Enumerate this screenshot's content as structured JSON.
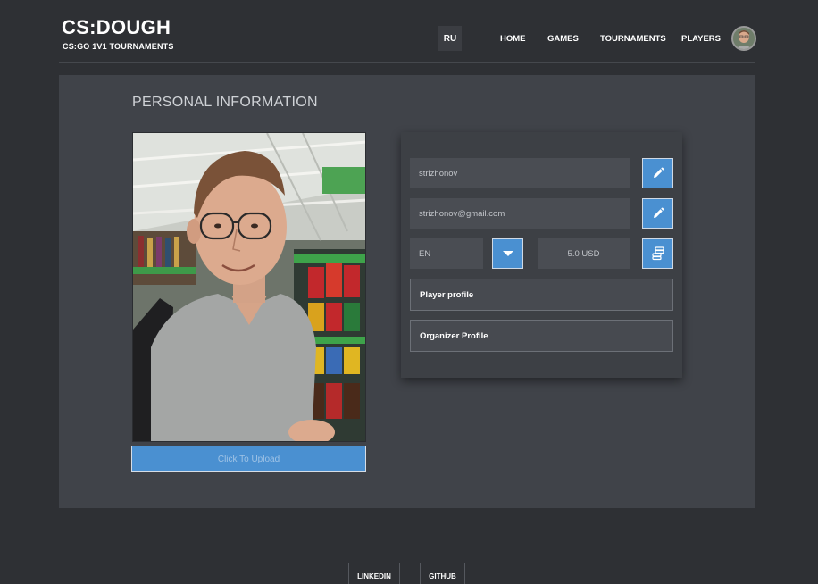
{
  "brand": {
    "title": "CS:DOUGH",
    "subtitle": "CS:GO 1V1 TOURNAMENTS"
  },
  "header": {
    "language": "RU",
    "nav": [
      "HOME",
      "GAMES",
      "TOURNAMENTS",
      "PLAYERS"
    ]
  },
  "profile": {
    "section_title": "PERSONAL INFORMATION",
    "upload_label": "Click To Upload",
    "username": "strizhonov",
    "email": "strizhonov@gmail.com",
    "language": "EN",
    "balance": "5.0 USD",
    "player_profile_label": "Player profile",
    "organizer_profile_label": "Organizer Profile"
  },
  "footer": {
    "links": [
      "LINKEDIN",
      "GITHUB"
    ]
  },
  "colors": {
    "accent": "#4a90d1",
    "background": "#2e3034",
    "panel": "#404349"
  },
  "icons": [
    "pencil-icon",
    "chevron-down-icon",
    "coins-icon",
    "avatar"
  ]
}
